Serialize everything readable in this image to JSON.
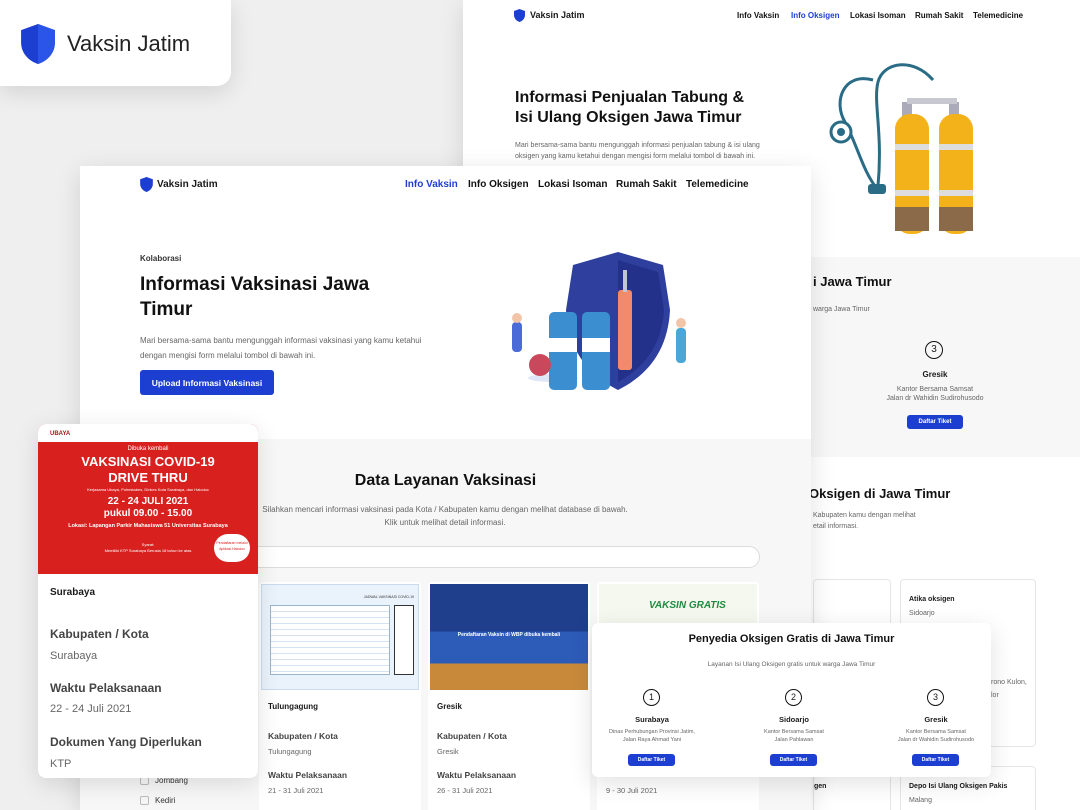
{
  "logo_badge": {
    "title": "Vaksin Jatim"
  },
  "back_page": {
    "brand": "Vaksin Jatim",
    "nav": [
      "Info Vaksin",
      "Info Oksigen",
      "Lokasi Isoman",
      "Rumah Sakit",
      "Telemedicine"
    ],
    "hero_title": "Informasi Penjualan Tabung & Isi Ulang Oksigen Jawa Timur",
    "hero_desc": "Mari bersama-sama bantu mengunggah informasi penjualan tabung & isi ulang oksigen yang kamu ketahui dengan mengisi form melalui tombol di bawah ini.",
    "section1_title": "i Jawa Timur",
    "section1_sub": "warga Jawa Timur",
    "item3": {
      "num": "3",
      "city": "Gresik",
      "addr1": "Kantor Bersama Samsat",
      "addr2": "Jalan dr Wahidin Sudirohusodo",
      "btn": "Daftar Tiket"
    },
    "section2_title": "Oksigen di Jawa Timur",
    "section2_sub1": "Kabupaten kamu dengan melihat",
    "section2_sub2": "etail informasi.",
    "card_a_title": "Atika oksigen",
    "card_a_city": "Sidoarjo",
    "card_a_addr1": "rono Kulon,",
    "card_a_addr2": "lor",
    "card_b_title": "Depo Isi Ulang Oksigen Pakis",
    "card_b_city": "Malang",
    "card_c_title": "gen"
  },
  "main_page": {
    "brand": "Vaksin Jatim",
    "nav": [
      "Info Vaksin",
      "Info Oksigen",
      "Lokasi Isoman",
      "Rumah Sakit",
      "Telemedicine"
    ],
    "kicker": "Kolaborasi",
    "hero_title": "Informasi Vaksinasi Jawa Timur",
    "hero_desc": "Mari bersama-sama bantu mengunggah informasi vaksinasi yang kamu ketahui dengan mengisi form melalui tombol di bawah ini.",
    "upload_btn": "Upload Informasi Vaksinasi",
    "data_title": "Data Layanan Vaksinasi",
    "data_desc": "Silahkan mencari informasi vaksinasi pada Kota / Kabupaten kamu dengan melihat database di bawah. Klik untuk melihat detail informasi.",
    "filters": [
      "Jombang",
      "Kediri"
    ],
    "cards": [
      {
        "city": "Tulungagung",
        "label1": "Kabupaten / Kota",
        "val1": "Tulungagung",
        "label2": "Waktu Pelaksanaan",
        "val2": "21 - 31 Juli 2021"
      },
      {
        "city": "Gresik",
        "label1": "Kabupaten / Kota",
        "val1": "Gresik",
        "label2": "Waktu Pelaksanaan",
        "val2": "26 - 31 Juli 2021"
      },
      {
        "val2": "9 - 30 Juli 2021"
      }
    ],
    "poster2_title": "Pendaftaran Vaksin di WBP dibuka kembali",
    "poster3_title": "VAKSIN GRATIS",
    "poster1_title": "JADWAL VAKSINASI COVID-19"
  },
  "detail_card": {
    "poster_kicker": "Dibuka kembali",
    "poster_title1": "VAKSINASI COVID-19",
    "poster_title2": "DRIVE THRU",
    "poster_sub": "Kerjasama Ubaya, Polrestabes, Dinkes Kota Surabaya, dan Halodoc",
    "poster_date": "22 - 24 JULI 2021",
    "poster_time": "pukul 09.00 - 15.00",
    "poster_loc": "Lokasi: Lapangan Parkir Mahasiswa 51 Universitas Surabaya",
    "poster_req_label": "Syarat:",
    "poster_req": "Memiliki KTP Surabaya Berusia 18 tahun ke atas",
    "poster_app": "Pendaftaran melalui Aplikasi Halodoc",
    "poster_logo": "UBAYA",
    "city": "Surabaya",
    "label1": "Kabupaten / Kota",
    "val1": "Surabaya",
    "label2": "Waktu Pelaksanaan",
    "val2": "22 - 24 Juli 2021",
    "label3": "Dokumen Yang Diperlukan",
    "val3": "KTP"
  },
  "oxygen_popup": {
    "title": "Penyedia Oksigen Gratis di Jawa Timur",
    "subtitle": "Layanan Isi Ulang Oksigen gratis untuk warga Jawa Timur",
    "items": [
      {
        "num": "1",
        "city": "Surabaya",
        "addr1": "Dinas Perhubungan Provinsi Jatim,",
        "addr2": "Jalan Raya Ahmad Yani",
        "btn": "Daftar Tiket"
      },
      {
        "num": "2",
        "city": "Sidoarjo",
        "addr1": "Kantor Bersama Samsat",
        "addr2": "Jalan Pahlawan",
        "btn": "Daftar Tiket"
      },
      {
        "num": "3",
        "city": "Gresik",
        "addr1": "Kantor Bersama Samsat",
        "addr2": "Jalan dr Wahidin Sudirohusodo",
        "btn": "Daftar Tiket"
      }
    ]
  },
  "colors": {
    "accent": "#1d3fd1",
    "poster_red": "#d8201f",
    "tank_yellow": "#f4b21a"
  }
}
